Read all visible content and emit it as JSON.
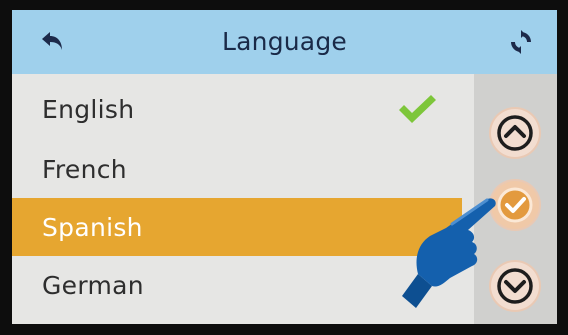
{
  "header": {
    "title": "Language",
    "back_icon": "back-arrow-icon",
    "refresh_icon": "refresh-icon"
  },
  "languages": [
    {
      "label": "English",
      "checked": true,
      "selected": false
    },
    {
      "label": "French",
      "checked": false,
      "selected": false
    },
    {
      "label": "Spanish",
      "checked": false,
      "selected": true
    },
    {
      "label": "German",
      "checked": false,
      "selected": false
    }
  ],
  "side_controls": {
    "up_icon": "chevron-up-icon",
    "confirm_icon": "confirm-check-icon",
    "down_icon": "chevron-down-icon"
  },
  "colors": {
    "header_bg": "#9fd0ec",
    "selected_bg": "#e6a630",
    "check_green": "#7dc63a",
    "button_accent": "#e39a3e"
  }
}
